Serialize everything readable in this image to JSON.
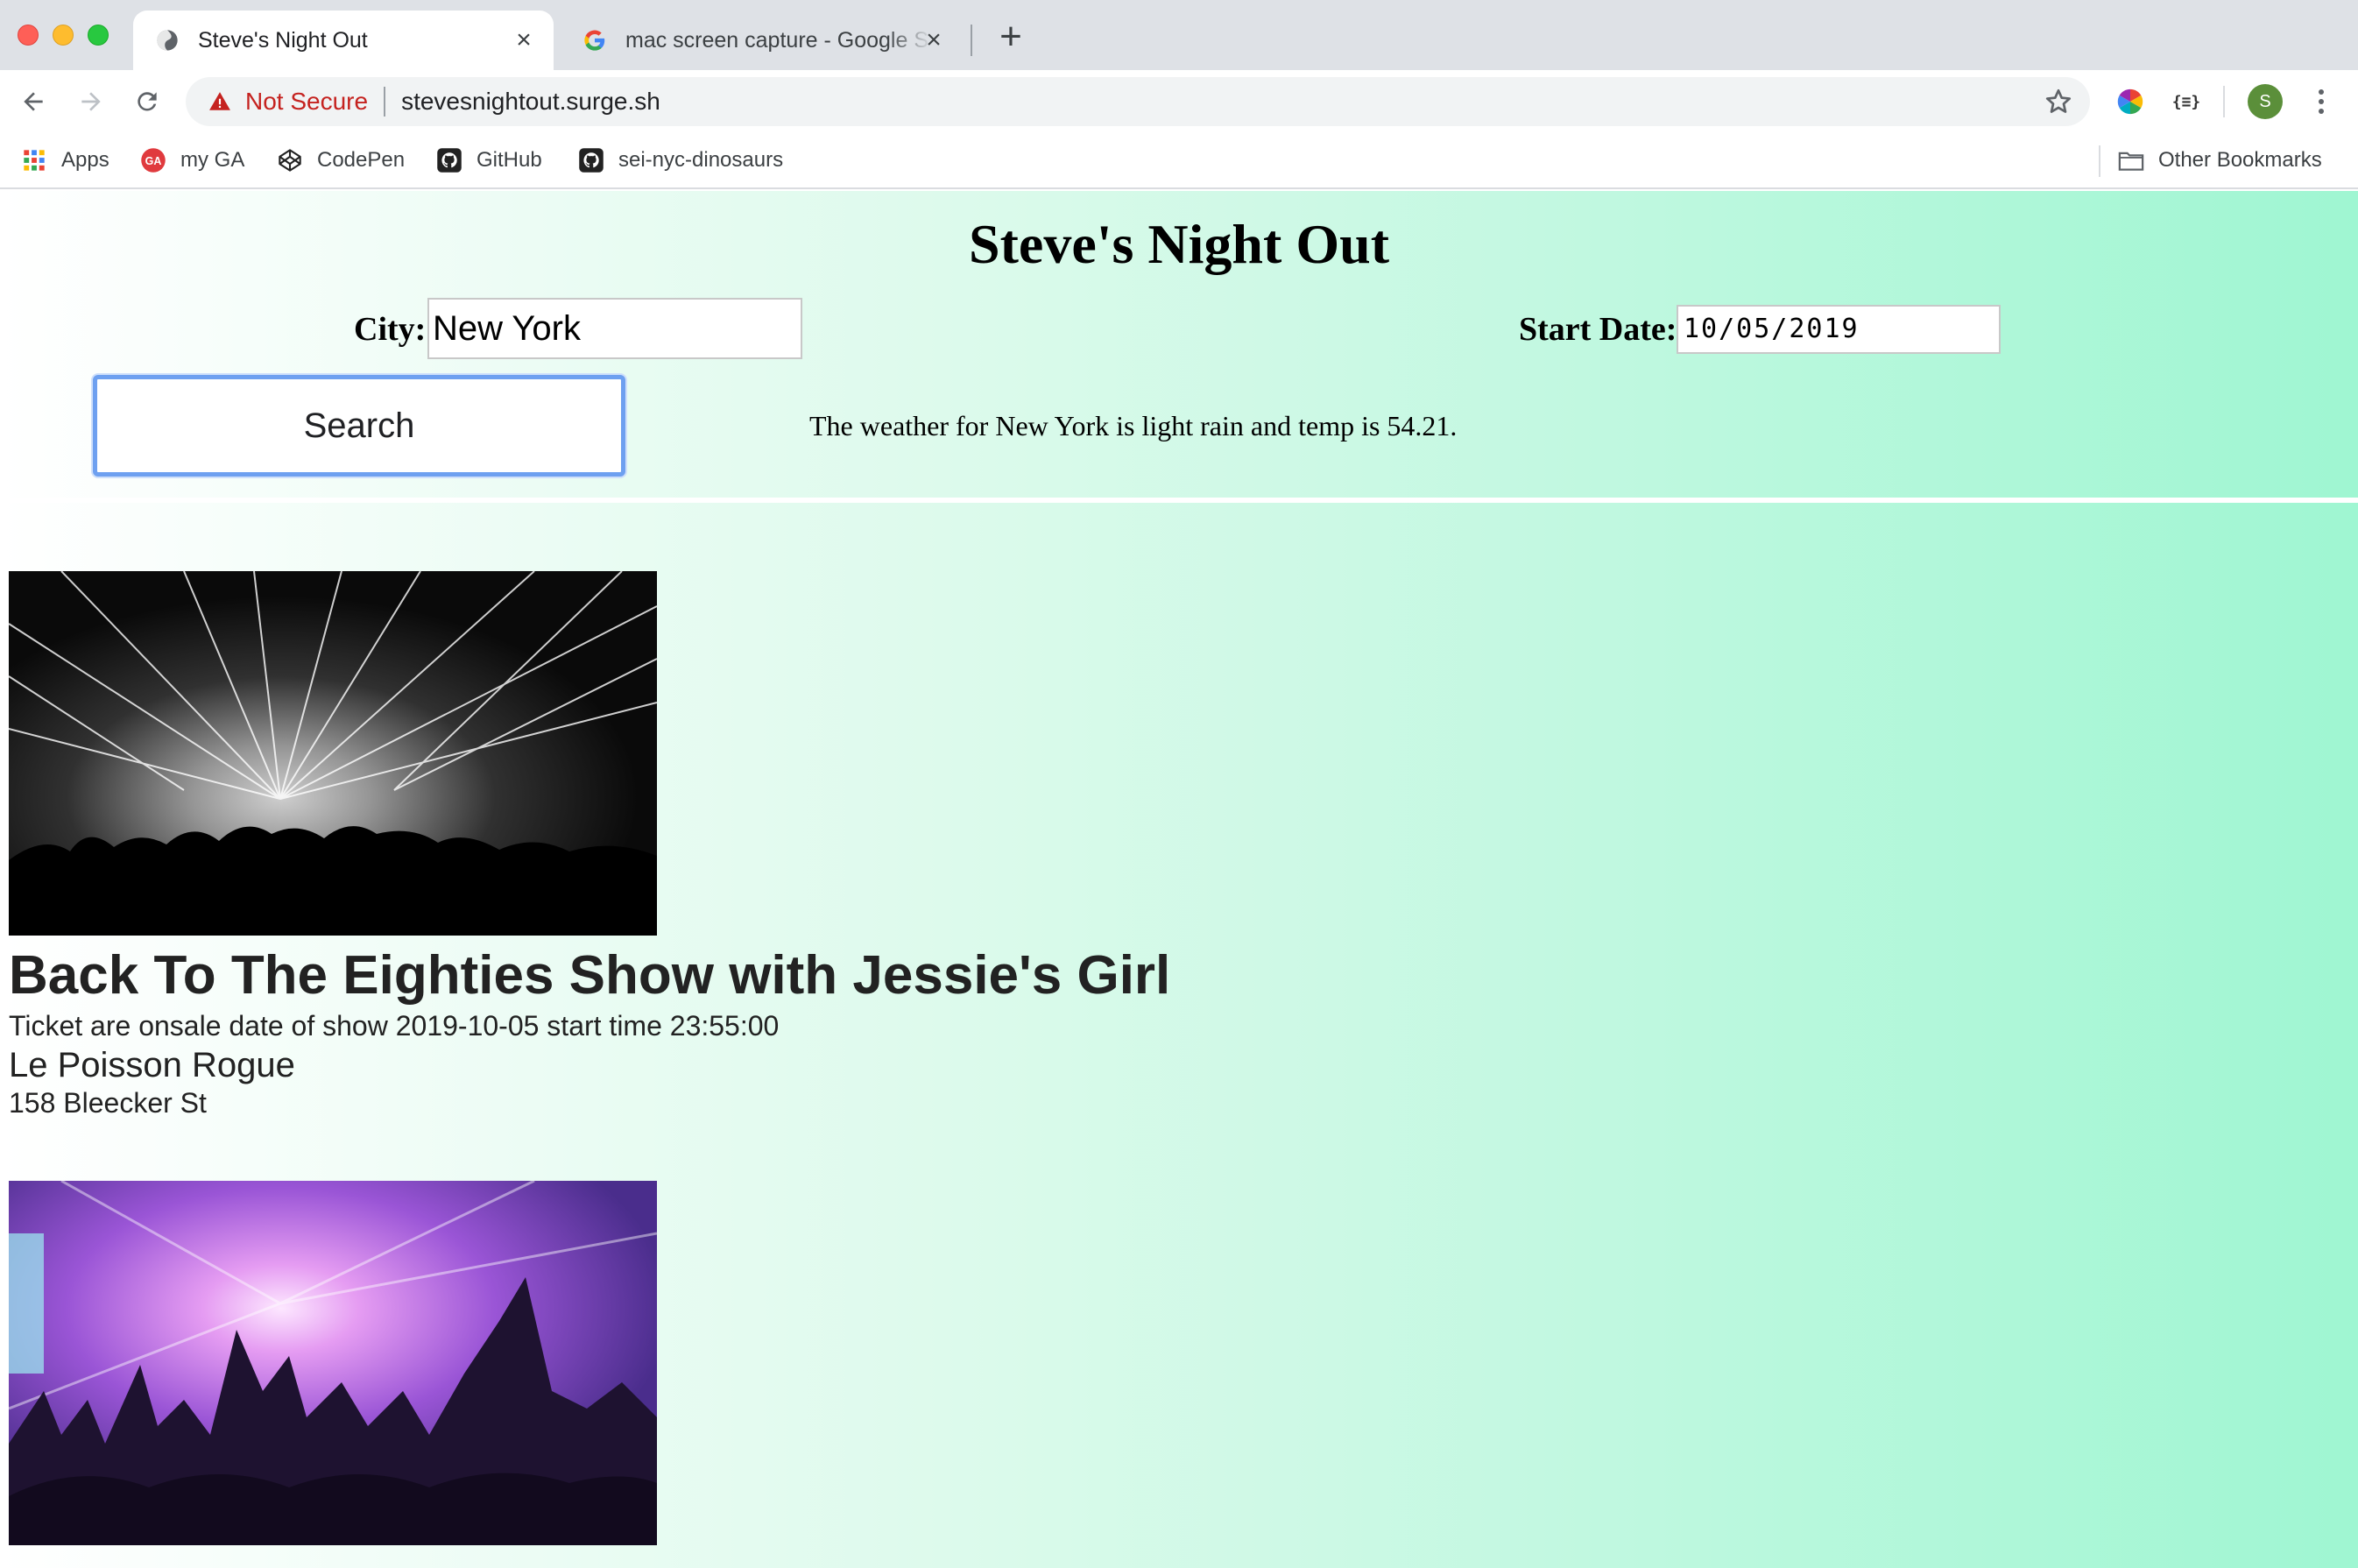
{
  "browser": {
    "tabs": [
      {
        "title": "Steve's Night Out",
        "active": true,
        "favicon": "globe-icon"
      },
      {
        "title": "mac screen capture - Google S",
        "active": false,
        "favicon": "google-icon"
      }
    ],
    "security_label": "Not Secure",
    "url": "stevesnightout.surge.sh",
    "avatar_letter": "S",
    "json_ext_label": "{≡}",
    "bookmarks": [
      {
        "label": "Apps",
        "icon": "apps-grid-icon"
      },
      {
        "label": "my GA",
        "icon": "ga-icon"
      },
      {
        "label": "CodePen",
        "icon": "codepen-icon"
      },
      {
        "label": "GitHub",
        "icon": "github-icon"
      },
      {
        "label": "sei-nyc-dinosaurs",
        "icon": "github-icon"
      }
    ],
    "other_bookmarks": "Other Bookmarks"
  },
  "page": {
    "title": "Steve's Night Out",
    "city_label": "City:",
    "city_value": "New York",
    "start_date_label": "Start Date:",
    "start_date_value": "10/05/2019",
    "search_label": "Search",
    "weather_text": "The weather for New York is light rain and temp is 54.21.",
    "events": [
      {
        "title": "Back To The Eighties Show with Jessie's Girl",
        "date_text": "Ticket are onsale date of show 2019-10-05 start time 23:55:00",
        "venue": "Le Poisson Rogue",
        "address": "158 Bleecker St",
        "image": "concert-lasers-photo"
      },
      {
        "title": "",
        "image": "concert-crowd-purple-photo"
      }
    ]
  },
  "colors": {
    "accent_focus": "#6ea0f0",
    "not_secure": "#c5221f",
    "gradient_end": "#9ff6d2"
  }
}
